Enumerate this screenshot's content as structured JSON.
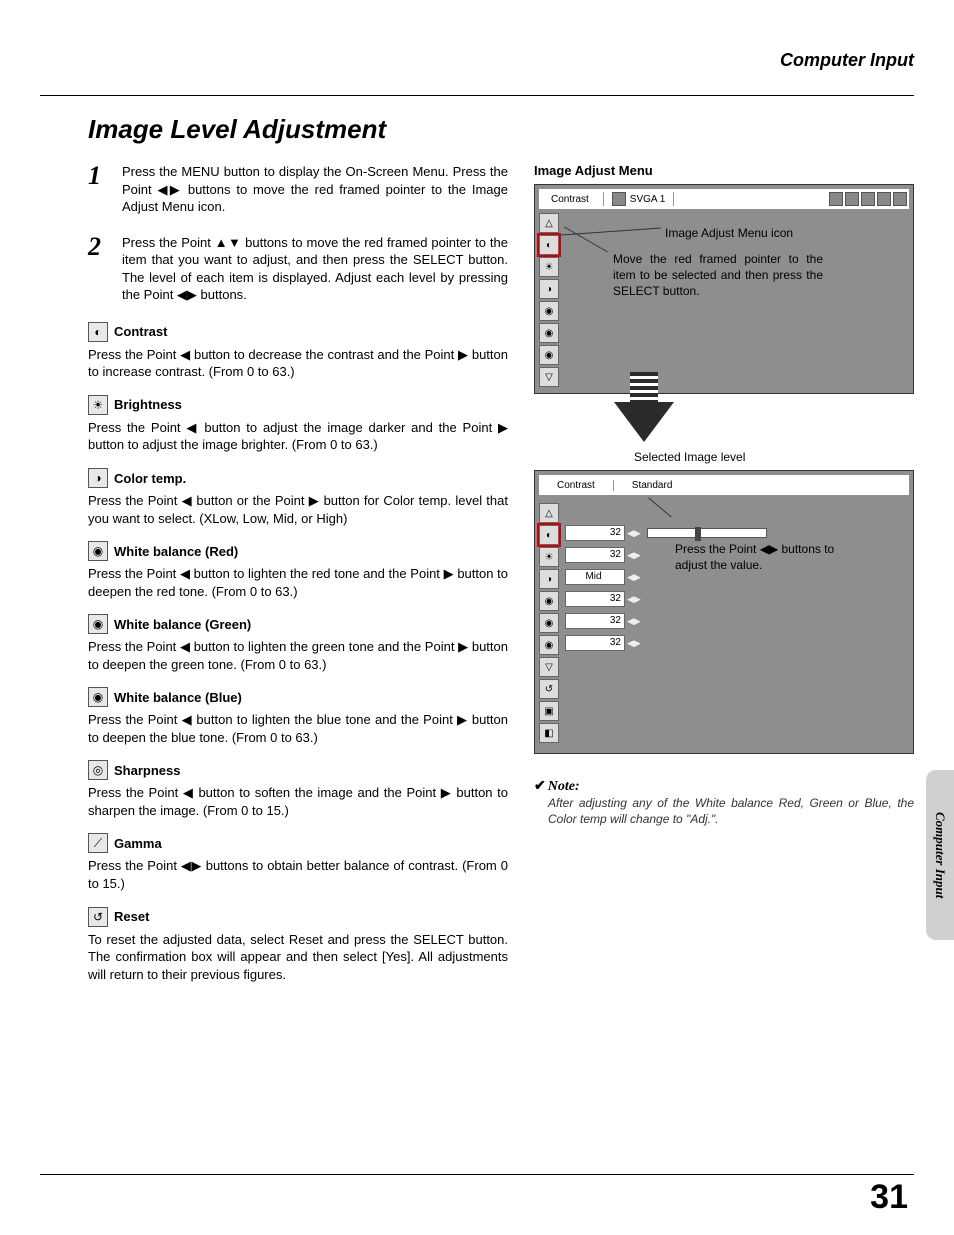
{
  "header": {
    "section": "Computer Input"
  },
  "title": "Image Level Adjustment",
  "steps": [
    {
      "num": "1",
      "text": "Press the MENU button to display the On-Screen Menu.  Press the Point ◀▶ buttons to move the red framed pointer to the Image Adjust Menu icon."
    },
    {
      "num": "2",
      "text": "Press the Point ▲▼ buttons to move the red framed pointer to the item that you want to adjust, and then press the SELECT button.  The level of each item is displayed.  Adjust each level by pressing the Point ◀▶ buttons."
    }
  ],
  "items": [
    {
      "icon": "◐",
      "title": "Contrast",
      "body": "Press the Point ◀ button to decrease the contrast and the Point ▶ button to increase contrast.  (From 0 to 63.)"
    },
    {
      "icon": "☀",
      "title": "Brightness",
      "body": "Press the Point ◀ button to adjust the image darker and the Point ▶ button to adjust the image brighter.  (From 0 to 63.)"
    },
    {
      "icon": "◑",
      "title": "Color temp.",
      "body": "Press the Point ◀ button or the Point ▶ button for Color temp. level that you want to select. (XLow, Low, Mid, or High)"
    },
    {
      "icon": "◉",
      "title": "White balance (Red)",
      "body": "Press the Point ◀ button to lighten the red tone and the Point ▶ button to deepen the red tone.  (From 0 to 63.)"
    },
    {
      "icon": "◉",
      "title": "White balance (Green)",
      "body": "Press the Point ◀ button to lighten the green tone and the Point ▶ button to deepen the green tone.  (From 0 to 63.)"
    },
    {
      "icon": "◉",
      "title": "White balance (Blue)",
      "body": "Press the Point ◀ button to lighten the blue tone and the Point ▶ button to deepen the blue tone.  (From 0 to 63.)"
    },
    {
      "icon": "◎",
      "title": "Sharpness",
      "body": "Press the Point ◀ button to soften the image and the Point ▶ button to sharpen the image.  (From 0 to 15.)"
    },
    {
      "icon": "⟋",
      "title": "Gamma",
      "body": "Press the Point ◀▶ buttons to obtain better balance of contrast.  (From 0 to 15.)"
    },
    {
      "icon": "↺",
      "title": "Reset",
      "body": "To reset the adjusted data, select Reset and press the SELECT button.  The confirmation box will appear and then select [Yes].  All adjustments will return to their previous figures."
    }
  ],
  "right": {
    "heading": "Image Adjust Menu",
    "menu_top": {
      "label": "Contrast",
      "mode": "SVGA 1"
    },
    "callout1": "Image Adjust Menu icon",
    "callout2": "Move the red framed pointer to the item to be selected and then press the SELECT button.",
    "selected_label": "Selected Image level",
    "menu2_head": {
      "a": "Contrast",
      "b": "Standard"
    },
    "values": [
      "32",
      "32",
      "Mid",
      "32",
      "32",
      "32"
    ],
    "callout3": "Press the Point ◀▶ buttons to adjust the value."
  },
  "note": {
    "head": "Note:",
    "body": "After adjusting any of the White balance Red, Green or Blue, the Color temp will change to \"Adj.\"."
  },
  "side_tab": "Computer Input",
  "page_number": "31"
}
